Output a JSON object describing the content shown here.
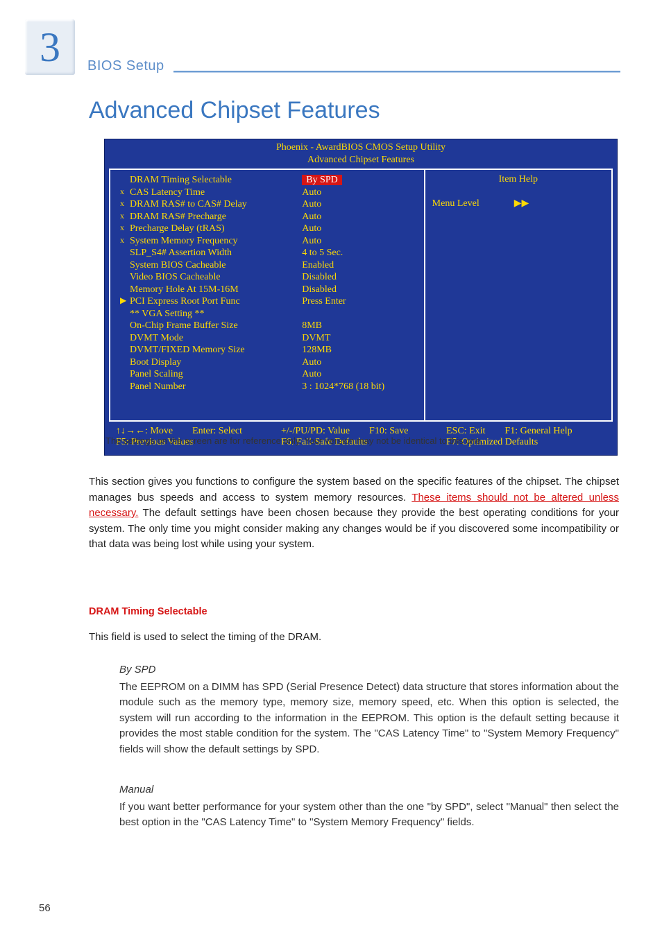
{
  "chapter": {
    "number": "3",
    "label": "BIOS Setup"
  },
  "title": "Advanced Chipset Features",
  "bios": {
    "utility_title": "Phoenix - AwardBIOS CMOS Setup Utility",
    "screen_title": "Advanced Chipset Features",
    "rows": [
      {
        "prefix": "",
        "name": "DRAM Timing Selectable",
        "value": "By SPD",
        "highlight": true
      },
      {
        "prefix": "x",
        "name": "CAS Latency Time",
        "value": "Auto"
      },
      {
        "prefix": "x",
        "name": "DRAM RAS# to CAS# Delay",
        "value": "Auto"
      },
      {
        "prefix": "x",
        "name": "DRAM RAS# Precharge",
        "value": "Auto"
      },
      {
        "prefix": "x",
        "name": "Precharge Delay (tRAS)",
        "value": "Auto"
      },
      {
        "prefix": "x",
        "name": "System Memory Frequency",
        "value": "Auto"
      },
      {
        "prefix": "",
        "name": "SLP_S4# Assertion Width",
        "value": "4 to 5 Sec."
      },
      {
        "prefix": "",
        "name": "System BIOS Cacheable",
        "value": "Enabled"
      },
      {
        "prefix": "",
        "name": "Video BIOS Cacheable",
        "value": "Disabled"
      },
      {
        "prefix": "",
        "name": "Memory Hole At 15M-16M",
        "value": "Disabled"
      },
      {
        "prefix": "▶",
        "name": "PCI Express Root Port Func",
        "value": "Press Enter"
      },
      {
        "prefix": "",
        "name": "",
        "value": ""
      },
      {
        "prefix": "",
        "name": "** VGA Setting **",
        "value": ""
      },
      {
        "prefix": "",
        "name": "On-Chip Frame Buffer Size",
        "value": "8MB"
      },
      {
        "prefix": "",
        "name": "DVMT Mode",
        "value": "DVMT"
      },
      {
        "prefix": "",
        "name": "DVMT/FIXED Memory Size",
        "value": "128MB"
      },
      {
        "prefix": "",
        "name": "Boot Display",
        "value": "Auto"
      },
      {
        "prefix": "",
        "name": "Panel Scaling",
        "value": "Auto"
      },
      {
        "prefix": "",
        "name": "Panel Number",
        "value": "3 : 1024*768 (18 bit)"
      }
    ],
    "help": {
      "title": "Item Help",
      "menu_level": "Menu Level",
      "arrows": "▶▶"
    },
    "footer": {
      "l1a": "↑↓→←: Move",
      "l1b": "Enter: Select",
      "l2": "F5: Previous Values",
      "m1a": "+/-/PU/PD: Value",
      "m1b": "F10: Save",
      "m2": "F6: Fail-Safe Defaults",
      "r1a": "ESC: Exit",
      "r1b": "F1: General Help",
      "r2": "F7: Optimized Defaults"
    }
  },
  "caption": "The settings on the screen are for reference only. Your version may not be identical to this one.",
  "para1_a": "This section gives you functions to configure the system based on the specific features of the chipset. The chipset manages bus speeds and access to system memory resources. ",
  "para1_warn": "These items should not be altered unless necessary.",
  "para1_b": " The default settings have been chosen because they provide the best operating conditions for your system. The only time you might consider making any changes would be if you discovered some incompatibility or that data was being lost while using your system.",
  "h_dram": "DRAM Timing Selectable",
  "para2": "This field is used to select the timing of the DRAM.",
  "byspd_head": "By SPD",
  "byspd_body": "The EEPROM on a DIMM has SPD (Serial Presence Detect) data structure that stores information about the module such as the memory type, memory size, memory speed, etc. When this option is selected, the system will run according to the information in the EEPROM. This option is the default setting because it provides the most stable condition for the system. The \"CAS Latency Time\" to \"System Memory Frequency\" fields will show the default settings by SPD.",
  "manual_head": "Manual",
  "manual_body": "If you want better performance for your system other than the one \"by SPD\", select \"Manual\" then select the best option in the \"CAS Latency Time\" to \"System Memory Frequency\" fields.",
  "page_number": "56"
}
